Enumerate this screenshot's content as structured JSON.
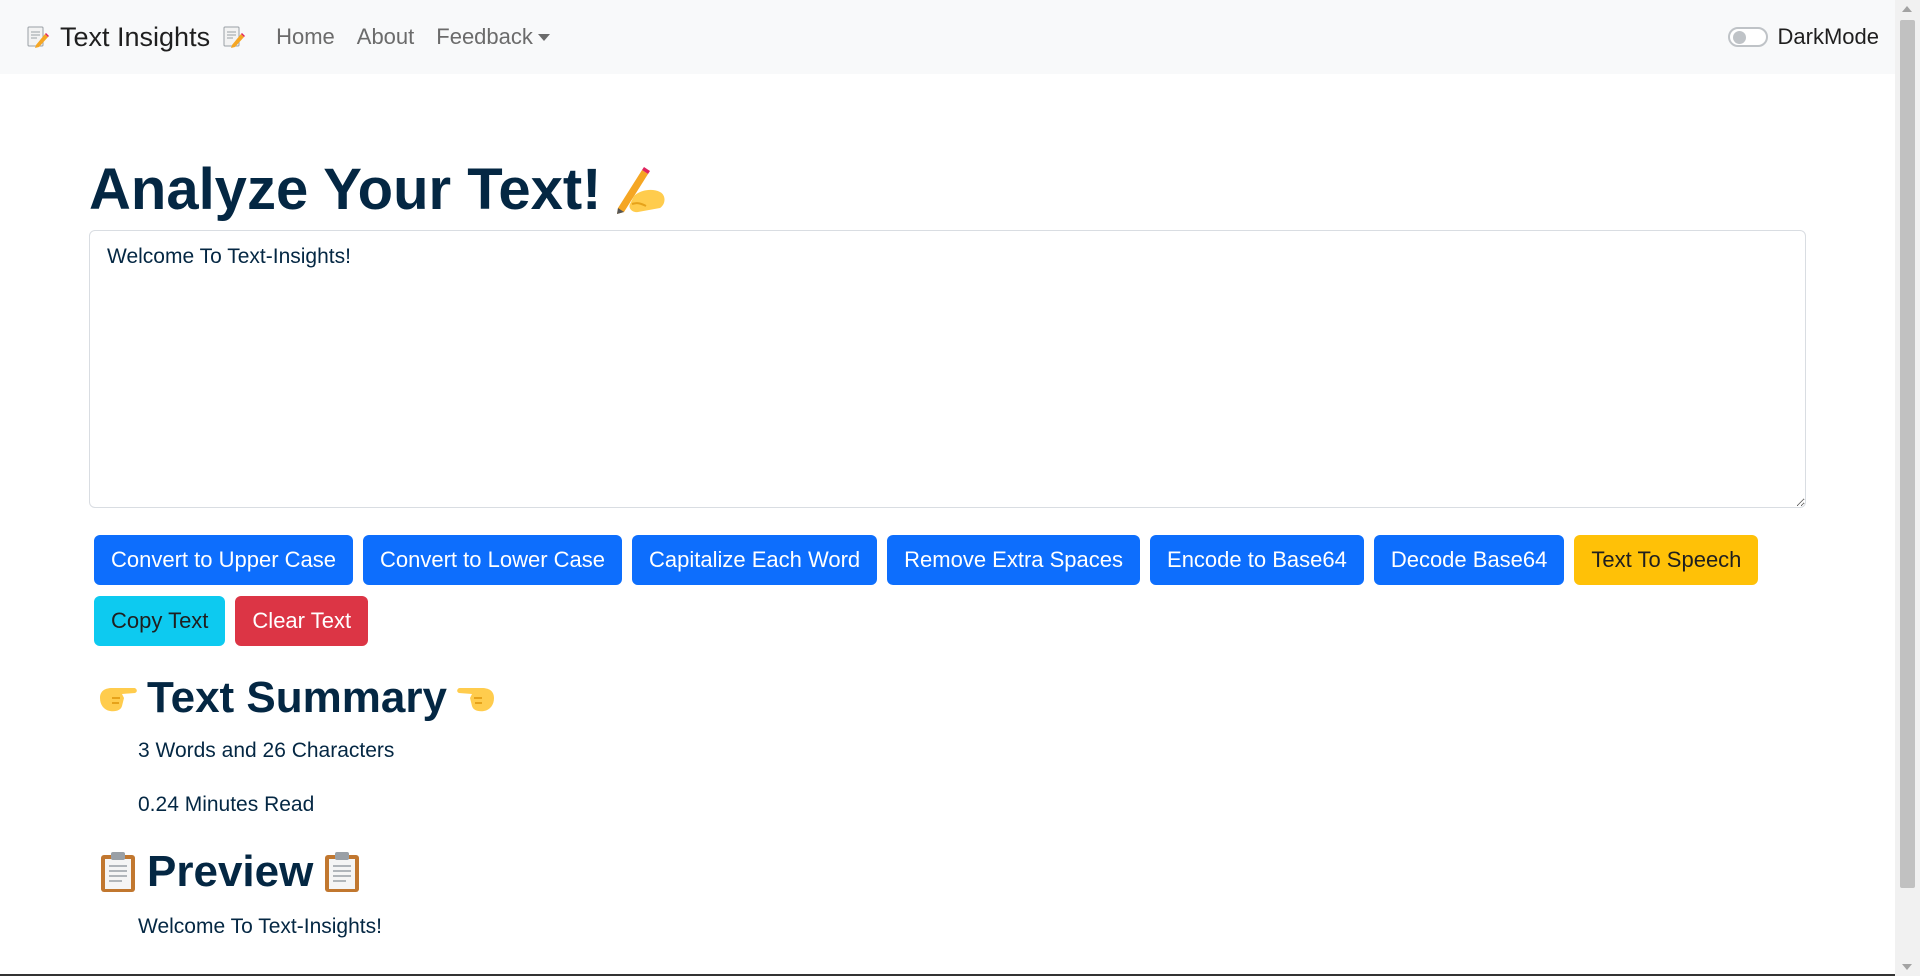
{
  "navbar": {
    "brand": "Text Insights",
    "brand_icon": "memo-icon",
    "links": [
      {
        "label": "Home"
      },
      {
        "label": "About"
      },
      {
        "label": "Feedback"
      }
    ],
    "darkmode_label": "DarkMode",
    "darkmode_on": false
  },
  "main": {
    "heading": "Analyze Your Text!",
    "heading_icon": "writing-hand-icon",
    "textarea_value": "Welcome To Text-Insights!",
    "buttons": [
      {
        "label": "Convert to Upper Case",
        "color": "#0d6efd"
      },
      {
        "label": "Convert to Lower Case",
        "color": "#0d6efd"
      },
      {
        "label": "Capitalize Each Word",
        "color": "#0d6efd"
      },
      {
        "label": "Remove Extra Spaces",
        "color": "#0d6efd"
      },
      {
        "label": "Encode to Base64",
        "color": "#0d6efd"
      },
      {
        "label": "Decode Base64",
        "color": "#0d6efd"
      },
      {
        "label": "Text To Speech",
        "color": "#ffc107"
      },
      {
        "label": "Copy Text",
        "color": "#0dcaf0"
      },
      {
        "label": "Clear Text",
        "color": "#dc3545"
      }
    ]
  },
  "summary": {
    "title": "Text Summary",
    "icons": [
      "pointing-right-icon",
      "pointing-left-icon"
    ],
    "words_chars": "3 Words and 26 Characters",
    "read_time": "0.24 Minutes Read"
  },
  "preview": {
    "title": "Preview",
    "icon": "clipboard-icon",
    "text": "Welcome To Text-Insights!"
  },
  "colors": {
    "text": "#042743",
    "navbar_bg": "#f8f9fa",
    "primary": "#0d6efd",
    "warning": "#ffc107",
    "info": "#0dcaf0",
    "danger": "#dc3545"
  }
}
